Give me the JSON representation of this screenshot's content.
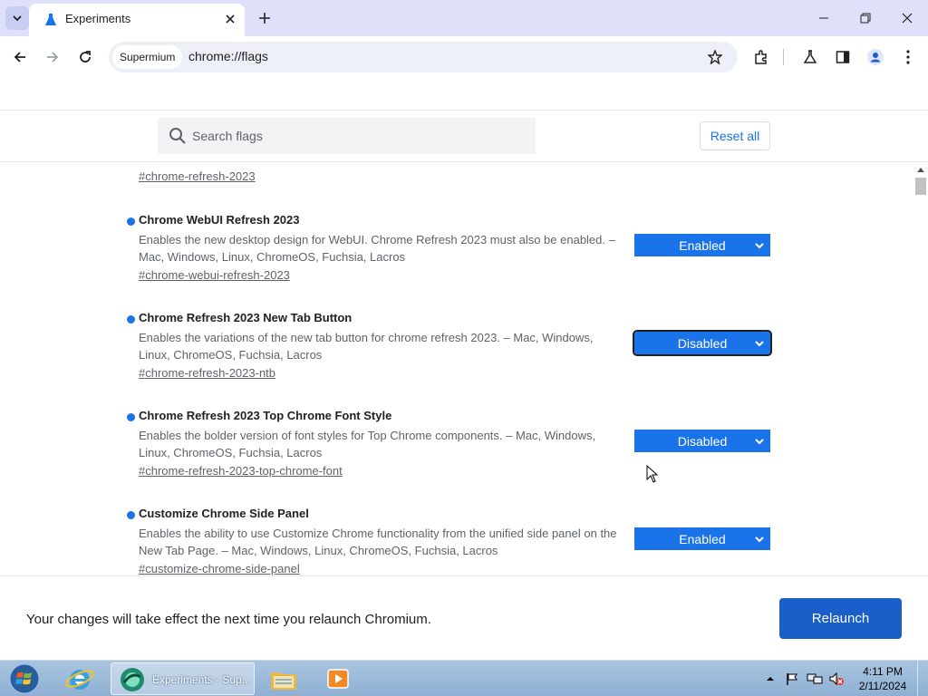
{
  "browser": {
    "tab": {
      "title": "Experiments"
    },
    "omnibox": {
      "chip": "Supermium",
      "url": "chrome://flags"
    }
  },
  "flags_page": {
    "search": {
      "placeholder": "Search flags"
    },
    "reset_all": "Reset all",
    "previous_flag_link": "#chrome-refresh-2023",
    "flags": [
      {
        "name": "Chrome WebUI Refresh 2023",
        "description": "Enables the new desktop design for WebUI. Chrome Refresh 2023 must also be enabled. – Mac, Windows, Linux, ChromeOS, Fuchsia, Lacros",
        "link": "#chrome-webui-refresh-2023",
        "value": "Enabled"
      },
      {
        "name": "Chrome Refresh 2023 New Tab Button",
        "description": "Enables the variations of the new tab button for chrome refresh 2023. – Mac, Windows, Linux, ChromeOS, Fuchsia, Lacros",
        "link": "#chrome-refresh-2023-ntb",
        "value": "Disabled"
      },
      {
        "name": "Chrome Refresh 2023 Top Chrome Font Style",
        "description": "Enables the bolder version of font styles for Top Chrome components. – Mac, Windows, Linux, ChromeOS, Fuchsia, Lacros",
        "link": "#chrome-refresh-2023-top-chrome-font",
        "value": "Disabled"
      },
      {
        "name": "Customize Chrome Side Panel",
        "description": "Enables the ability to use Customize Chrome functionality from the unified side panel on the New Tab Page. – Mac, Windows, Linux, ChromeOS, Fuchsia, Lacros",
        "link": "#customize-chrome-side-panel",
        "value": "Enabled"
      }
    ],
    "relaunch": {
      "message": "Your changes will take effect the next time you relaunch Chromium.",
      "button": "Relaunch"
    }
  },
  "taskbar": {
    "active_task": "Experiments - Sup...",
    "clock": {
      "time": "4:11 PM",
      "date": "2/11/2024"
    }
  },
  "colors": {
    "accent": "#1a73e8",
    "tabstrip": "#dee1f9",
    "omnibox": "#eef0f9"
  }
}
